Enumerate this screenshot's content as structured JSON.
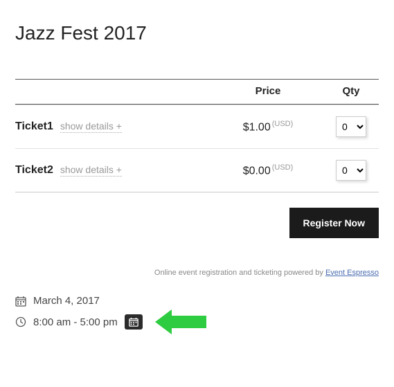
{
  "title": "Jazz Fest 2017",
  "headers": {
    "price": "Price",
    "qty": "Qty"
  },
  "show_details_label": "show details +",
  "tickets": [
    {
      "name": "Ticket1",
      "price": "$1.00",
      "currency": "(USD)",
      "qty": "0"
    },
    {
      "name": "Ticket2",
      "price": "$0.00",
      "currency": "(USD)",
      "qty": "0"
    }
  ],
  "register_label": "Register Now",
  "powered": {
    "text": "Online event registration and ticketing powered by ",
    "link_text": "Event Espresso"
  },
  "event": {
    "date": "March 4, 2017",
    "time": "8:00 am - 5:00 pm"
  }
}
